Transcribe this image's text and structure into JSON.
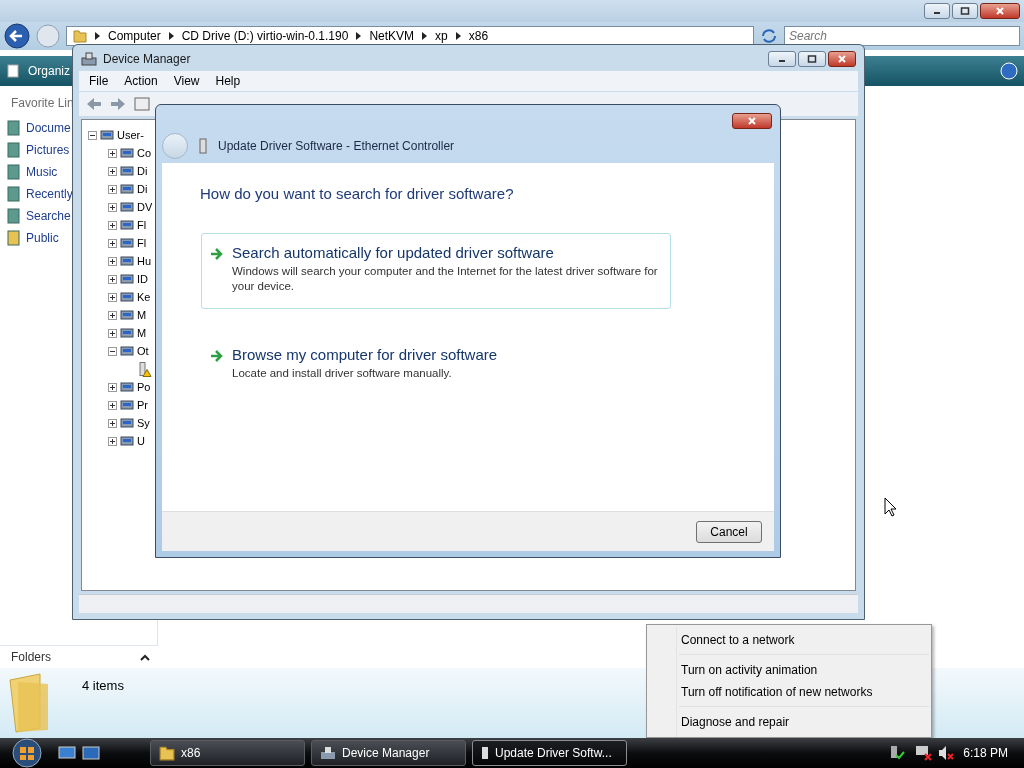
{
  "explorer": {
    "address_path": [
      "Computer",
      "CD Drive (D:) virtio-win-0.1.190",
      "NetKVM",
      "xp",
      "x86"
    ],
    "search": {
      "placeholder": "Search"
    },
    "toolbar": {
      "organize": "Organiz"
    },
    "favorite_links": {
      "title": "Favorite Lin",
      "items": [
        "Docume",
        "Pictures",
        "Music",
        "Recently",
        "Searche",
        "Public"
      ]
    },
    "folders": "Folders",
    "details": {
      "count": "4 items"
    }
  },
  "device_manager": {
    "title": "Device Manager",
    "menu": [
      "File",
      "Action",
      "View",
      "Help"
    ],
    "tree": {
      "label": "User-",
      "expanded": true,
      "children": [
        {
          "label": "Co",
          "expanded": false
        },
        {
          "label": "Di",
          "expanded": false
        },
        {
          "label": "Di",
          "expanded": false
        },
        {
          "label": "DV",
          "expanded": false
        },
        {
          "label": "Fl",
          "expanded": false
        },
        {
          "label": "Fl",
          "expanded": false
        },
        {
          "label": "Hu",
          "expanded": false
        },
        {
          "label": "ID",
          "expanded": false
        },
        {
          "label": "Ke",
          "expanded": false
        },
        {
          "label": "M",
          "expanded": false
        },
        {
          "label": "M",
          "expanded": false
        },
        {
          "label": "Ot",
          "expanded": true,
          "children": [
            {
              "warning": true
            }
          ]
        },
        {
          "label": "Po",
          "expanded": false
        },
        {
          "label": "Pr",
          "expanded": false
        },
        {
          "label": "Sy",
          "expanded": false
        },
        {
          "label": "U",
          "expanded": false
        }
      ]
    }
  },
  "dialog": {
    "title": "Update Driver Software - Ethernet Controller",
    "heading": "How do you want to search for driver software?",
    "options": [
      {
        "title": "Search automatically for updated driver software",
        "description": "Windows will search your computer and the Internet for the latest driver software for your device.",
        "selected": true
      },
      {
        "title": "Browse my computer for driver software",
        "description": "Locate and install driver software manually.",
        "selected": false
      }
    ],
    "buttons": [
      "Cancel"
    ]
  },
  "context_menu": {
    "groups": [
      [
        "Connect to a network"
      ],
      [
        "Turn on activity animation",
        "Turn off notification of new networks"
      ],
      [
        "Diagnose and repair"
      ]
    ]
  },
  "taskbar": {
    "items": [
      {
        "label": "x86",
        "selected": false
      },
      {
        "label": "Device Manager",
        "selected": false
      },
      {
        "label": "Update Driver Softw...",
        "selected": true
      }
    ],
    "clock": "6:18 PM"
  }
}
